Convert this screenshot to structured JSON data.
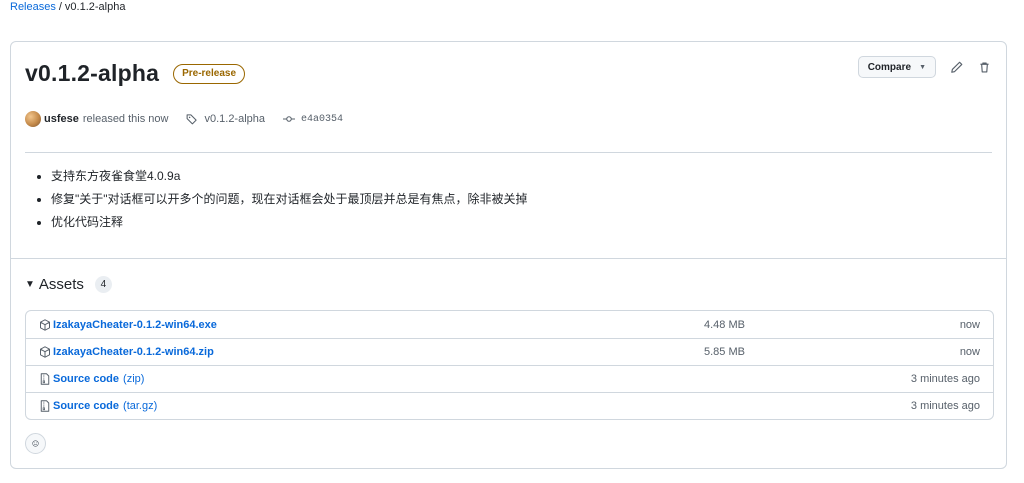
{
  "breadcrumb": {
    "root": "Releases",
    "separator": "/",
    "current": "v0.1.2-alpha"
  },
  "release": {
    "title": "v0.1.2-alpha",
    "badge": "Pre-release",
    "compare_label": "Compare",
    "author": "usfese",
    "released_text": "released this now",
    "tag": "v0.1.2-alpha",
    "commit": "e4a0354",
    "notes": [
      "支持东方夜雀食堂4.0.9a",
      "修复\"关于\"对话框可以开多个的问题，现在对话框会处于最顶层并总是有焦点，除非被关掉",
      "优化代码注释"
    ]
  },
  "assets": {
    "heading": "Assets",
    "count": "4",
    "items": [
      {
        "name": "IzakayaCheater-0.1.2-win64.exe",
        "sub": "",
        "size": "4.48 MB",
        "time": "now",
        "icon": "package-icon"
      },
      {
        "name": "IzakayaCheater-0.1.2-win64.zip",
        "sub": "",
        "size": "5.85 MB",
        "time": "now",
        "icon": "package-icon"
      },
      {
        "name": "Source code",
        "sub": "(zip)",
        "size": "",
        "time": "3 minutes ago",
        "icon": "file-zip-icon"
      },
      {
        "name": "Source code",
        "sub": "(tar.gz)",
        "size": "",
        "time": "3 minutes ago",
        "icon": "file-zip-icon"
      }
    ]
  },
  "colors": {
    "link": "#0969da",
    "prerelease": "#9a6700",
    "border": "#d0d7de"
  }
}
